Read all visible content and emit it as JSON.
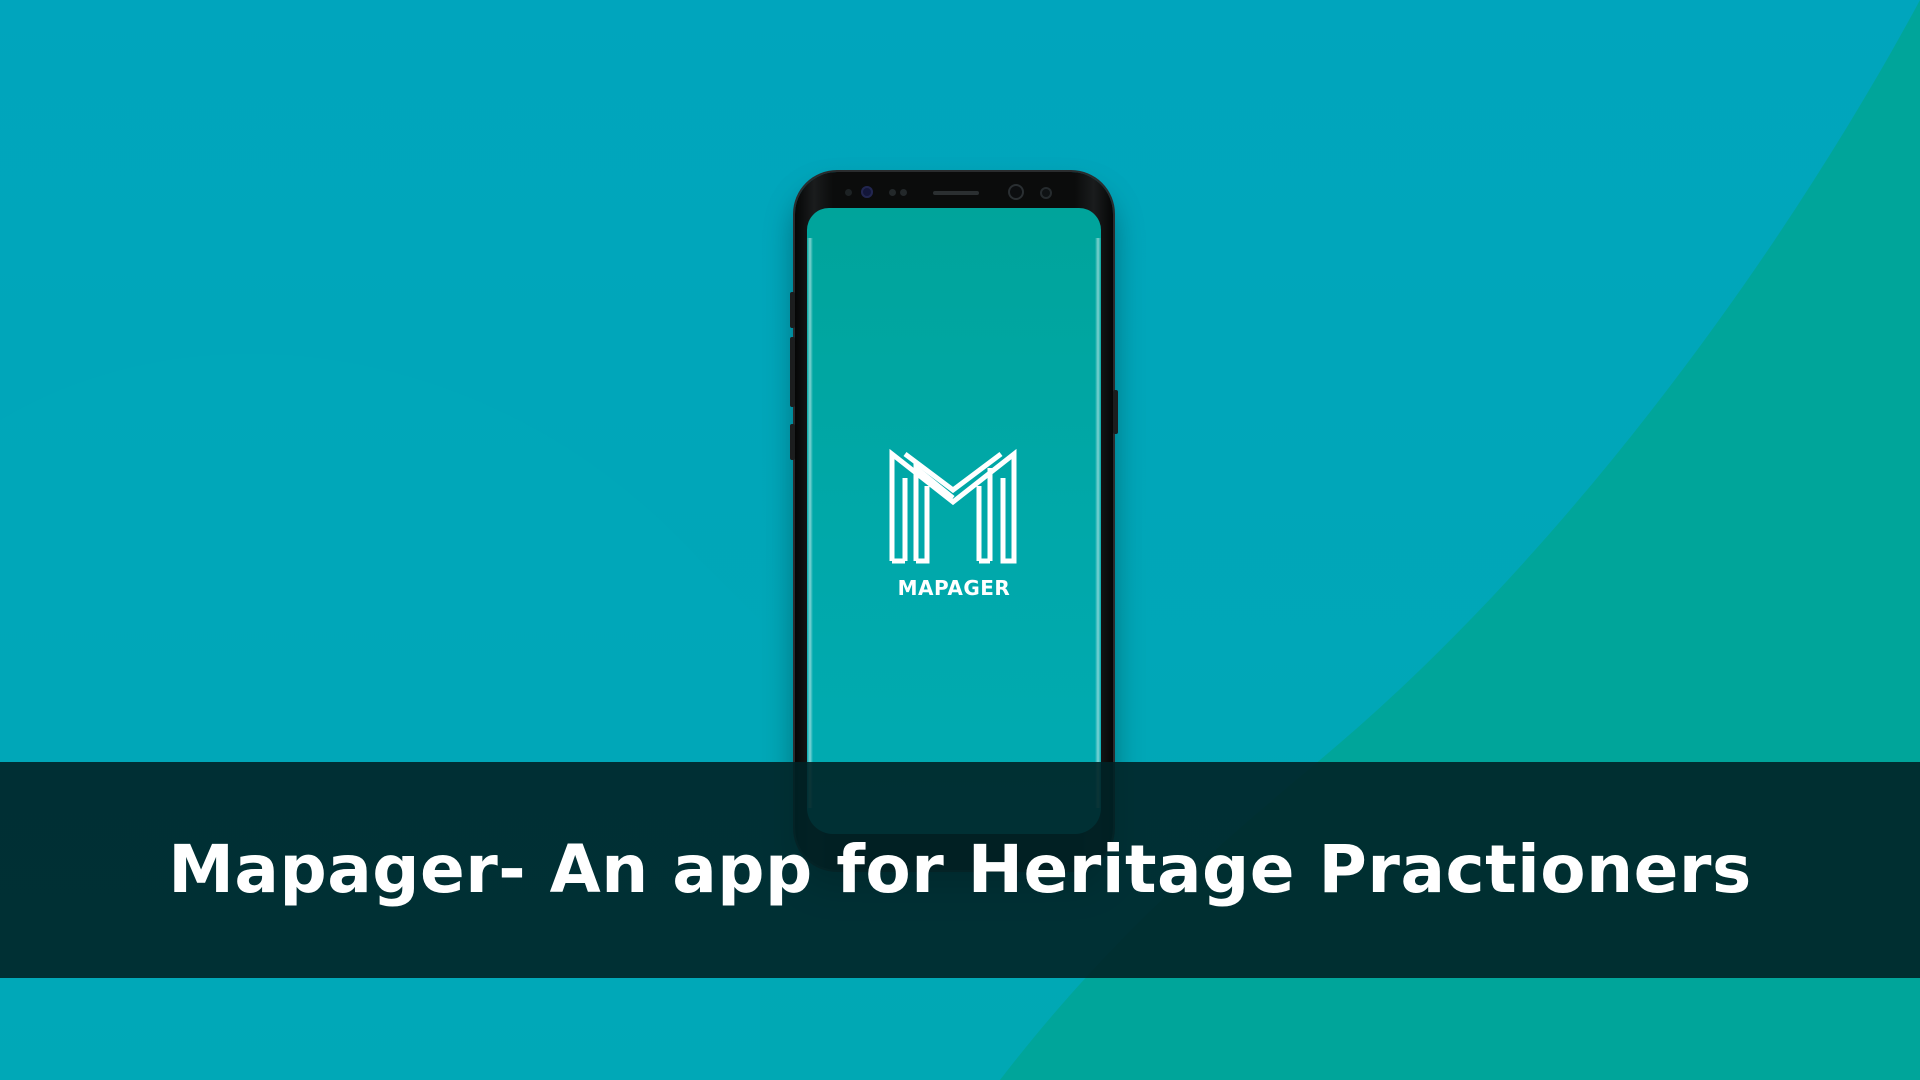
{
  "phone": {
    "app_name": "MAPAGER",
    "logo_icon": "mapager-m-logo-icon"
  },
  "banner": {
    "title": "Mapager- An app for Heritage Practioners"
  },
  "colors": {
    "background_teal": "#00a5bd",
    "background_green": "#00a498",
    "screen_teal": "#00a69f",
    "banner_dark": "#002a2e",
    "text_white": "#ffffff"
  }
}
